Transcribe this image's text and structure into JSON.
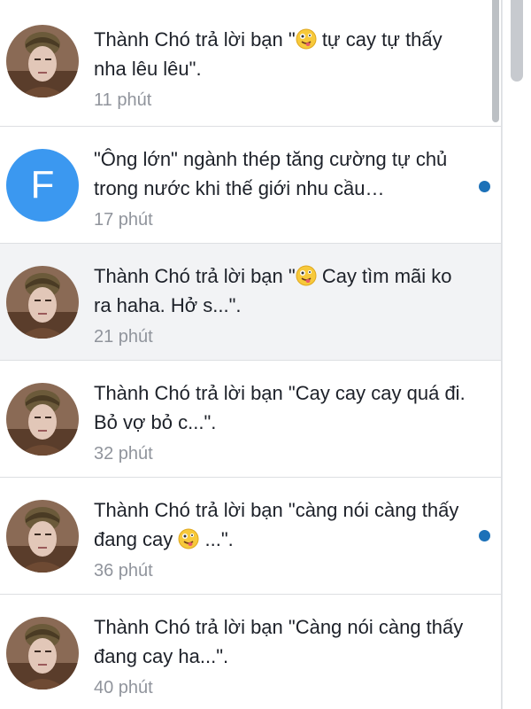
{
  "notifications": [
    {
      "text_before": "Thành Chó trả lời bạn \"",
      "text_after": " tự cay tự thấy nha lêu lêu\".",
      "time": "11 phút",
      "avatar": "profile-photo",
      "unread": false,
      "highlighted": false
    },
    {
      "text_before": "\"Ông lớn\" ngành thép tăng cường tự chủ trong nước khi thế giới nhu cầu…",
      "text_after": "",
      "time": "17 phút",
      "avatar": "letter",
      "avatar_letter": "F",
      "unread": true,
      "highlighted": false
    },
    {
      "text_before": "Thành Chó trả lời bạn \"",
      "text_after": " Cay tìm mãi ko ra haha. Hở s...\".",
      "time": "21 phút",
      "avatar": "profile-photo",
      "unread": false,
      "highlighted": true
    },
    {
      "text_before": "Thành Chó trả lời bạn \"Cay cay cay quá đi. Bỏ vợ bỏ c...\".",
      "text_after": "",
      "time": "32 phút",
      "avatar": "profile-photo",
      "unread": false,
      "highlighted": false
    },
    {
      "text_before": "Thành Chó trả lời bạn \"càng nói càng thấy đang cay ",
      "text_after": " ...\".",
      "time": "36 phút",
      "avatar": "profile-photo",
      "unread": true,
      "highlighted": false
    },
    {
      "text_before": "Thành Chó trả lời bạn \"Càng nói càng thấy đang cay ha...\".",
      "text_after": "",
      "time": "40 phút",
      "avatar": "profile-photo",
      "unread": false,
      "highlighted": false
    }
  ],
  "icons": {
    "emoji": "zany-face-emoji",
    "unread": "unread-dot-icon"
  },
  "colors": {
    "unread_dot": "#1c71b8",
    "highlight_bg": "#f2f3f5",
    "time_text": "#90949c",
    "letter_avatar_bg": "#3b98f0"
  }
}
